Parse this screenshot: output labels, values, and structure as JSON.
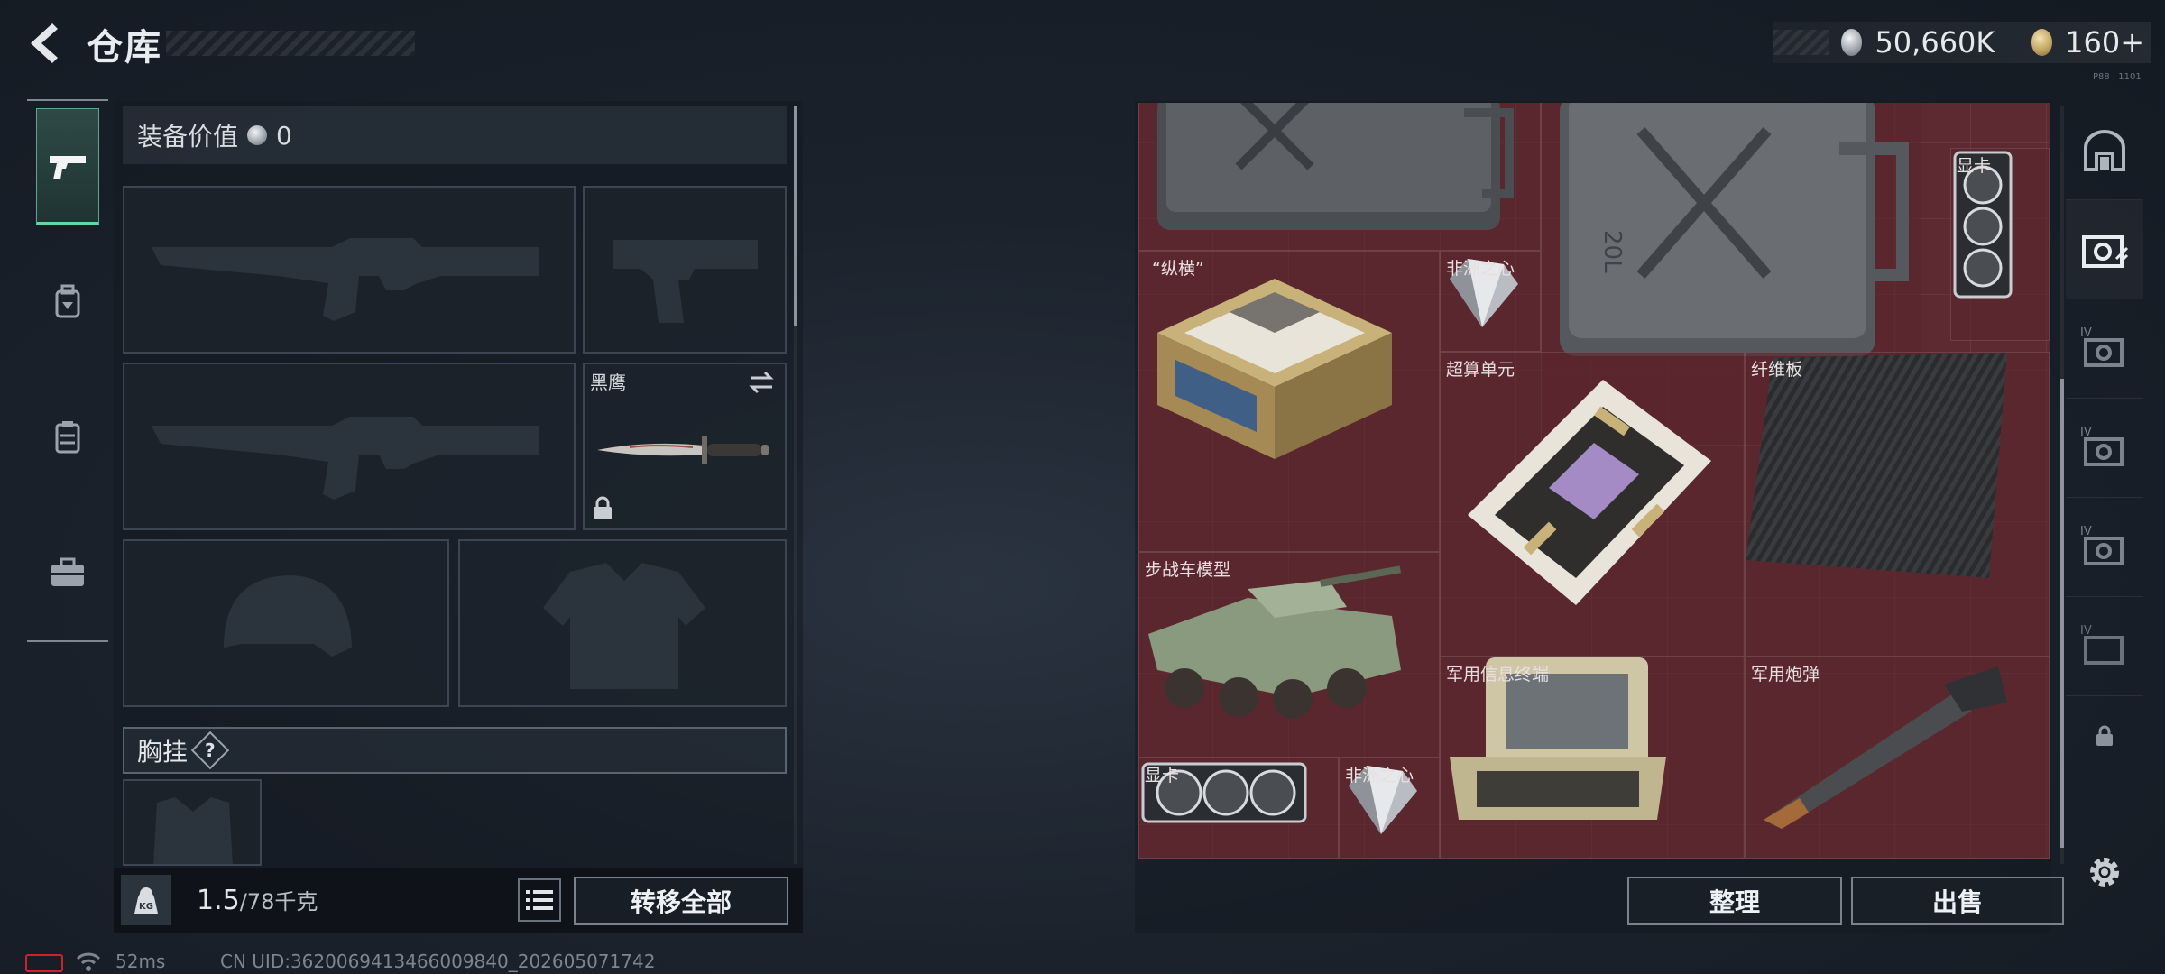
{
  "header": {
    "title": "仓库",
    "currency_primary": "50,660K",
    "currency_secondary": "160+",
    "version_mark": "P88 · 1101"
  },
  "left_nav": {
    "items": [
      {
        "id": "weapons",
        "icon": "pistol-icon",
        "active": true
      },
      {
        "id": "gear",
        "icon": "backpack-icon",
        "active": false
      },
      {
        "id": "chest-rig",
        "icon": "vest-icon",
        "active": false
      },
      {
        "id": "case",
        "icon": "briefcase-icon",
        "active": false
      }
    ]
  },
  "equipment": {
    "value_label": "装备价值",
    "value_amount": "0",
    "melee_label": "黑鹰",
    "chest_rig_label": "胸挂",
    "help_symbol": "?"
  },
  "bottom_bar": {
    "weight_current": "1.5",
    "weight_max": "/78千克",
    "transfer_all_label": "转移全部"
  },
  "storage": {
    "items": [
      {
        "name": "",
        "icon": "jerrycan-icon"
      },
      {
        "name": "",
        "icon": "jerrycan-20l-icon"
      },
      {
        "name": "显卡",
        "icon": "graphics-card-icon"
      },
      {
        "name": "“纵横”",
        "icon": "chess-set-icon"
      },
      {
        "name": "非洲之心",
        "icon": "diamond-icon"
      },
      {
        "name": "超算单元",
        "icon": "server-board-icon"
      },
      {
        "name": "纤维板",
        "icon": "carbon-fiber-icon"
      },
      {
        "name": "步战车模型",
        "icon": "ifv-model-icon"
      },
      {
        "name": "军用信息终端",
        "icon": "military-terminal-icon"
      },
      {
        "name": "军用炮弹",
        "icon": "artillery-shell-icon"
      },
      {
        "name": "显卡",
        "icon": "graphics-card-icon"
      },
      {
        "name": "非洲之心",
        "icon": "diamond-icon"
      }
    ],
    "sort_label": "整理",
    "sell_label": "出售"
  },
  "right_nav": {
    "tiers": [
      "IV",
      "IV",
      "IV",
      "IV"
    ]
  },
  "status": {
    "ping": "52ms",
    "uid": "CN UID:3620069413466009840_202605071742"
  },
  "colors": {
    "storage_bg": "#5e2a32",
    "active_accent": "#68d4a6",
    "battery_low": "#c8242a"
  }
}
